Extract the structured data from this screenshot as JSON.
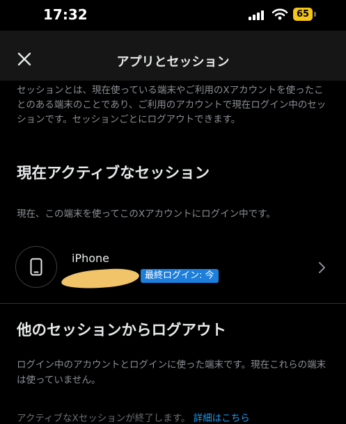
{
  "status_bar": {
    "time": "17:32",
    "battery_level": "65",
    "icons": [
      "signal-bars-icon",
      "wifi-icon",
      "battery-icon"
    ],
    "battery_color": "#f5c518"
  },
  "nav": {
    "title": "アプリとセッション",
    "close_icon": "close-icon"
  },
  "intro_text": "セッションとは、現在使っている端末やご利用のXアカウントを使ったことのある端末のことであり、ご利用のアカウントで現在ログイン中のセッションです。セッションごとにログアウトできます。",
  "active_section": {
    "title": "現在アクティブなセッション",
    "description": "現在、この端末を使ってこのXアカウントにログイン中です。",
    "session": {
      "device_icon": "smartphone-icon",
      "device_name": "iPhone",
      "badge": "最終ログイン: 今",
      "badge_color": "#1d7edb",
      "chevron_icon": "chevron-right-icon"
    }
  },
  "logout_section": {
    "title": "他のセッションからログアウト",
    "description": "ログイン中のアカウントとログインに使った端末です。現在これらの端末は使っていません。",
    "partial_text": "アクティブなXセッションが終了します。",
    "partial_link": "詳細はこちら"
  }
}
